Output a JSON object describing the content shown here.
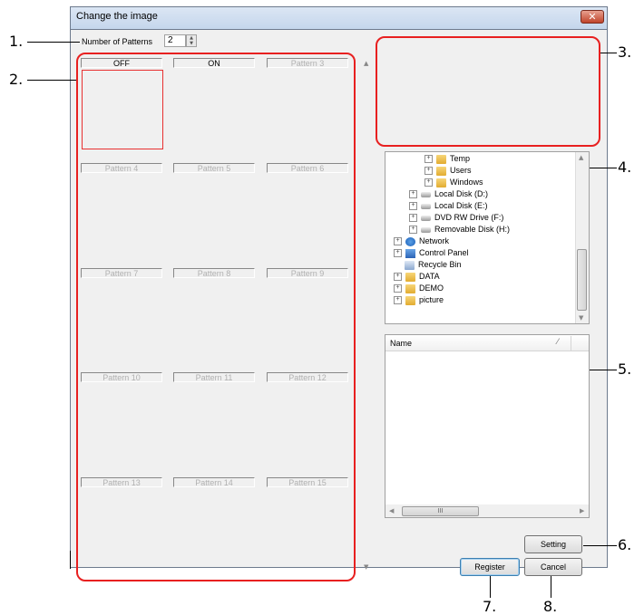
{
  "dialog": {
    "title": "Change the image",
    "close_glyph": "✕"
  },
  "callouts": [
    "1.",
    "2.",
    "3.",
    "4.",
    "5.",
    "6.",
    "7.",
    "8."
  ],
  "patterns": {
    "count_label": "Number of Patterns",
    "count_value": "2",
    "labels": [
      "OFF",
      "ON",
      "Pattern 3",
      "Pattern 4",
      "Pattern 5",
      "Pattern 6",
      "Pattern 7",
      "Pattern 8",
      "Pattern 9",
      "Pattern 10",
      "Pattern 11",
      "Pattern 12",
      "Pattern 13",
      "Pattern 14",
      "Pattern 15"
    ]
  },
  "tree": {
    "items": [
      {
        "label": "Temp",
        "icon": "folder-icon"
      },
      {
        "label": "Users",
        "icon": "folder-icon"
      },
      {
        "label": "Windows",
        "icon": "folder-icon"
      },
      {
        "label": "Local Disk (D:)",
        "icon": "disk-icon"
      },
      {
        "label": "Local Disk (E:)",
        "icon": "disk-icon"
      },
      {
        "label": "DVD RW Drive (F:)",
        "icon": "dvd-icon"
      },
      {
        "label": "Removable Disk (H:)",
        "icon": "removable-disk-icon"
      },
      {
        "label": "Network",
        "icon": "network-icon"
      },
      {
        "label": "Control Panel",
        "icon": "control-panel-icon"
      },
      {
        "label": "Recycle Bin",
        "icon": "recycle-bin-icon"
      },
      {
        "label": "DATA",
        "icon": "folder-icon"
      },
      {
        "label": "DEMO",
        "icon": "folder-icon"
      },
      {
        "label": "picture",
        "icon": "folder-icon"
      }
    ]
  },
  "filelist": {
    "column_name": "Name",
    "hscroll_grip": "III"
  },
  "buttons": {
    "setting": "Setting",
    "register": "Register",
    "cancel": "Cancel"
  },
  "colors": {
    "callout_border": "#e82020",
    "dialog_bg": "#f0f0f0"
  }
}
